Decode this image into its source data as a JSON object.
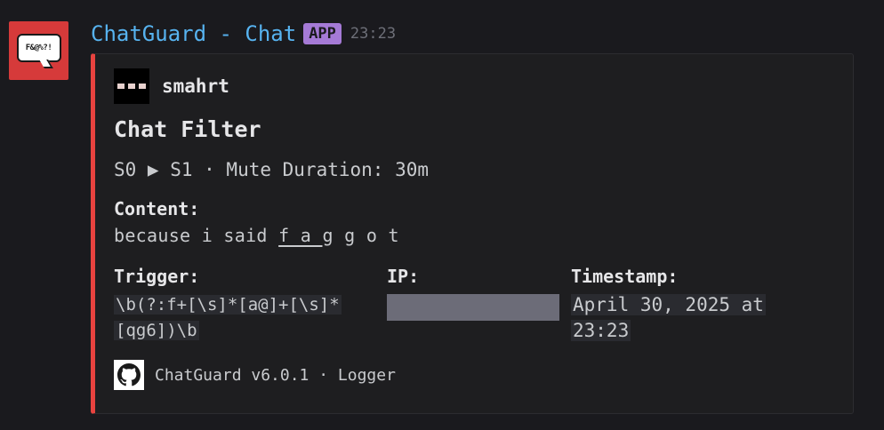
{
  "message": {
    "author": "ChatGuard - Chat",
    "badge": "APP",
    "time": "23:23",
    "avatar_text": "F&@%?!"
  },
  "embed": {
    "accent_color": "#e8433f",
    "author_name": "smahrt",
    "title": "Chat Filter",
    "description": "S0 ▶ S1 · Mute Duration: 30m",
    "content": {
      "label": "Content:",
      "prefix": "because i said ",
      "underlined": "f_a_",
      "suffix": "g g o t"
    },
    "fields": {
      "trigger": {
        "label": "Trigger:",
        "lines": [
          "\\b(?:f+[\\s]*[a@]+[\\s]*",
          "[qg6])\\b"
        ]
      },
      "ip": {
        "label": "IP:",
        "redacted": true
      },
      "timestamp": {
        "label": "Timestamp:",
        "lines": [
          "April 30, 2025 at",
          "23:23"
        ]
      }
    },
    "footer": {
      "icon": "github-icon",
      "text": "ChatGuard v6.0.1 · Logger"
    }
  }
}
